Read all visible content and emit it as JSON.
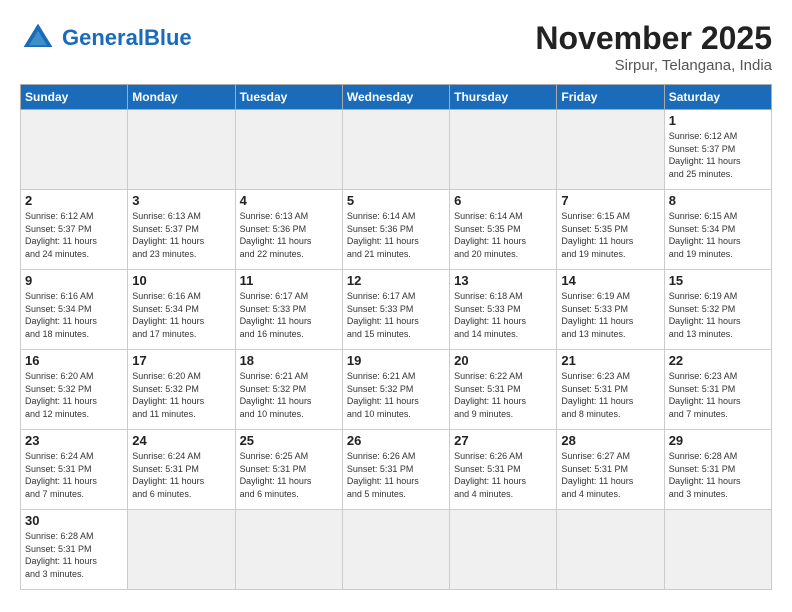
{
  "header": {
    "logo_general": "General",
    "logo_blue": "Blue",
    "month": "November 2025",
    "location": "Sirpur, Telangana, India"
  },
  "days_of_week": [
    "Sunday",
    "Monday",
    "Tuesday",
    "Wednesday",
    "Thursday",
    "Friday",
    "Saturday"
  ],
  "weeks": [
    [
      {
        "day": "",
        "info": ""
      },
      {
        "day": "",
        "info": ""
      },
      {
        "day": "",
        "info": ""
      },
      {
        "day": "",
        "info": ""
      },
      {
        "day": "",
        "info": ""
      },
      {
        "day": "",
        "info": ""
      },
      {
        "day": "1",
        "info": "Sunrise: 6:12 AM\nSunset: 5:37 PM\nDaylight: 11 hours\nand 25 minutes."
      }
    ],
    [
      {
        "day": "2",
        "info": "Sunrise: 6:12 AM\nSunset: 5:37 PM\nDaylight: 11 hours\nand 24 minutes."
      },
      {
        "day": "3",
        "info": "Sunrise: 6:13 AM\nSunset: 5:37 PM\nDaylight: 11 hours\nand 23 minutes."
      },
      {
        "day": "4",
        "info": "Sunrise: 6:13 AM\nSunset: 5:36 PM\nDaylight: 11 hours\nand 22 minutes."
      },
      {
        "day": "5",
        "info": "Sunrise: 6:14 AM\nSunset: 5:36 PM\nDaylight: 11 hours\nand 21 minutes."
      },
      {
        "day": "6",
        "info": "Sunrise: 6:14 AM\nSunset: 5:35 PM\nDaylight: 11 hours\nand 20 minutes."
      },
      {
        "day": "7",
        "info": "Sunrise: 6:15 AM\nSunset: 5:35 PM\nDaylight: 11 hours\nand 19 minutes."
      },
      {
        "day": "8",
        "info": "Sunrise: 6:15 AM\nSunset: 5:34 PM\nDaylight: 11 hours\nand 19 minutes."
      }
    ],
    [
      {
        "day": "9",
        "info": "Sunrise: 6:16 AM\nSunset: 5:34 PM\nDaylight: 11 hours\nand 18 minutes."
      },
      {
        "day": "10",
        "info": "Sunrise: 6:16 AM\nSunset: 5:34 PM\nDaylight: 11 hours\nand 17 minutes."
      },
      {
        "day": "11",
        "info": "Sunrise: 6:17 AM\nSunset: 5:33 PM\nDaylight: 11 hours\nand 16 minutes."
      },
      {
        "day": "12",
        "info": "Sunrise: 6:17 AM\nSunset: 5:33 PM\nDaylight: 11 hours\nand 15 minutes."
      },
      {
        "day": "13",
        "info": "Sunrise: 6:18 AM\nSunset: 5:33 PM\nDaylight: 11 hours\nand 14 minutes."
      },
      {
        "day": "14",
        "info": "Sunrise: 6:19 AM\nSunset: 5:33 PM\nDaylight: 11 hours\nand 13 minutes."
      },
      {
        "day": "15",
        "info": "Sunrise: 6:19 AM\nSunset: 5:32 PM\nDaylight: 11 hours\nand 13 minutes."
      }
    ],
    [
      {
        "day": "16",
        "info": "Sunrise: 6:20 AM\nSunset: 5:32 PM\nDaylight: 11 hours\nand 12 minutes."
      },
      {
        "day": "17",
        "info": "Sunrise: 6:20 AM\nSunset: 5:32 PM\nDaylight: 11 hours\nand 11 minutes."
      },
      {
        "day": "18",
        "info": "Sunrise: 6:21 AM\nSunset: 5:32 PM\nDaylight: 11 hours\nand 10 minutes."
      },
      {
        "day": "19",
        "info": "Sunrise: 6:21 AM\nSunset: 5:32 PM\nDaylight: 11 hours\nand 10 minutes."
      },
      {
        "day": "20",
        "info": "Sunrise: 6:22 AM\nSunset: 5:31 PM\nDaylight: 11 hours\nand 9 minutes."
      },
      {
        "day": "21",
        "info": "Sunrise: 6:23 AM\nSunset: 5:31 PM\nDaylight: 11 hours\nand 8 minutes."
      },
      {
        "day": "22",
        "info": "Sunrise: 6:23 AM\nSunset: 5:31 PM\nDaylight: 11 hours\nand 7 minutes."
      }
    ],
    [
      {
        "day": "23",
        "info": "Sunrise: 6:24 AM\nSunset: 5:31 PM\nDaylight: 11 hours\nand 7 minutes."
      },
      {
        "day": "24",
        "info": "Sunrise: 6:24 AM\nSunset: 5:31 PM\nDaylight: 11 hours\nand 6 minutes."
      },
      {
        "day": "25",
        "info": "Sunrise: 6:25 AM\nSunset: 5:31 PM\nDaylight: 11 hours\nand 6 minutes."
      },
      {
        "day": "26",
        "info": "Sunrise: 6:26 AM\nSunset: 5:31 PM\nDaylight: 11 hours\nand 5 minutes."
      },
      {
        "day": "27",
        "info": "Sunrise: 6:26 AM\nSunset: 5:31 PM\nDaylight: 11 hours\nand 4 minutes."
      },
      {
        "day": "28",
        "info": "Sunrise: 6:27 AM\nSunset: 5:31 PM\nDaylight: 11 hours\nand 4 minutes."
      },
      {
        "day": "29",
        "info": "Sunrise: 6:28 AM\nSunset: 5:31 PM\nDaylight: 11 hours\nand 3 minutes."
      }
    ],
    [
      {
        "day": "30",
        "info": "Sunrise: 6:28 AM\nSunset: 5:31 PM\nDaylight: 11 hours\nand 3 minutes."
      },
      {
        "day": "",
        "info": ""
      },
      {
        "day": "",
        "info": ""
      },
      {
        "day": "",
        "info": ""
      },
      {
        "day": "",
        "info": ""
      },
      {
        "day": "",
        "info": ""
      },
      {
        "day": "",
        "info": ""
      }
    ]
  ]
}
